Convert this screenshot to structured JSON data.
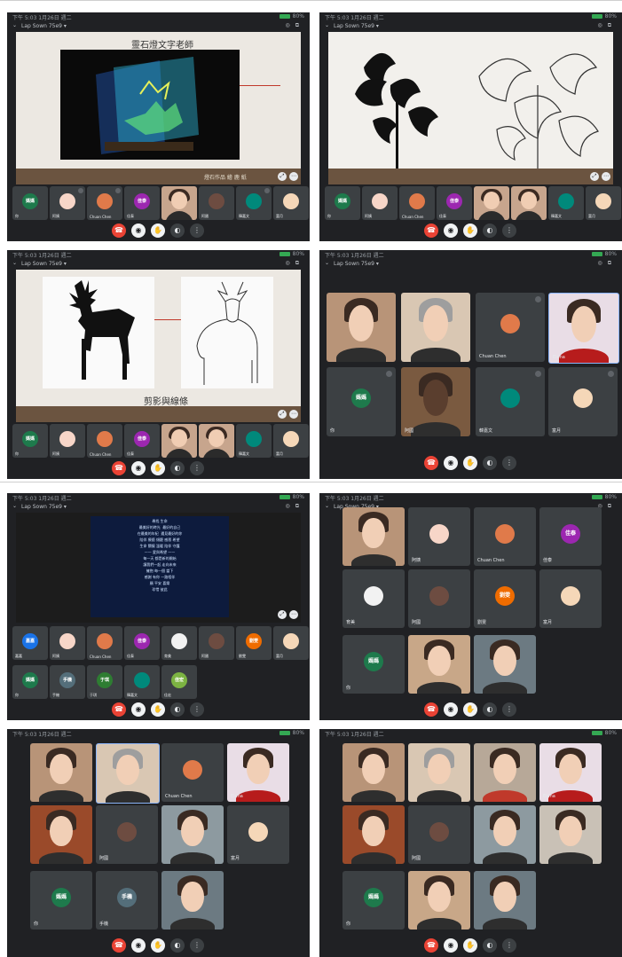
{
  "meeting": {
    "status_time": "下午 5:03  1月26日 週二",
    "battery": "80%",
    "title": "Lap Sown 75e9 ▾"
  },
  "shots": {
    "s1": {
      "slide_title": "靈石燈文字老師",
      "slide_caption": "燈石作品 繪 鹿 紙"
    },
    "s2": {
      "slide_title": ""
    },
    "s3": {
      "slide_caption": "剪影與線條"
    },
    "s5": {
      "video_text": "尋找 生命\n最美好的時光  最好的自己\n在最美的年紀  遇見最好的你\n陪伴 療癒 傾聽 感恩 希望\n生命 關懷 溫暖 陪伴 守護\n—— 愛與希望 ——\n每一天 都是新的開始\n讓我們一起 走向未來\n擁抱 每一個 當下\n感謝 有你 一路相伴\n願 平安 喜樂\n珍惜 彼此"
    }
  },
  "participants": {
    "name_a": "媽媽",
    "name_b": "阿姨",
    "name_c": "Chuan Chen",
    "name_d": "佳泰",
    "name_e": "阿國",
    "name_f": "韓嘉文",
    "name_g": "富月",
    "name_h": "Elena",
    "name_i": "嘉嘉",
    "name_j": "手機",
    "name_k": "于琪",
    "name_l": "佳宏",
    "name_m": "育美",
    "name_n": "陳媽媽",
    "name_o": "劉雯",
    "you": "你",
    "av_a": "媽媽",
    "av_d": "佳泰",
    "av_j": "手機",
    "av_k": "于琪",
    "av_l": "佳宏",
    "av_o": "劉雯",
    "av_i": "嘉嘉"
  },
  "controls": {
    "end_icon": "☎",
    "mic_icon": "◉",
    "hand_icon": "✋",
    "cam_icon": "◐",
    "more_icon": "⋮"
  },
  "colors": {
    "green_avatar": "#1e7a4c",
    "purple_avatar": "#9c27b0",
    "teal_avatar": "#00897b",
    "orange_avatar": "#ef6c00",
    "blue_avatar": "#1a73e8",
    "end_call": "#ea4335"
  }
}
